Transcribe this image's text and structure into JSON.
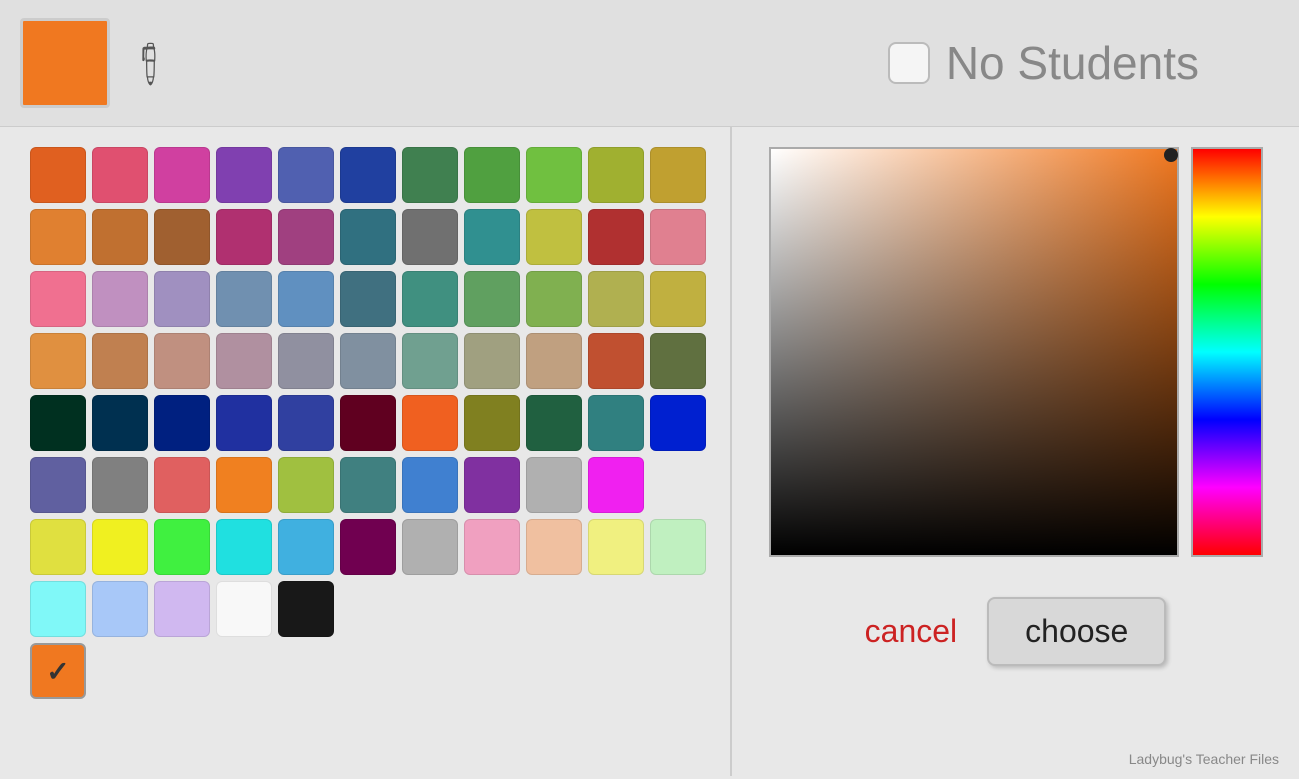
{
  "header": {
    "selected_color": "#f07820",
    "no_students_label": "No Students"
  },
  "palette": {
    "colors": [
      "#e06020",
      "#e05070",
      "#d040a0",
      "#8040b0",
      "#5060b0",
      "#2040a0",
      "#408050",
      "#50a040",
      "#70c040",
      "#a0b030",
      "#c0a030",
      "#e08030",
      "#c07030",
      "#a06030",
      "#b03070",
      "#a04080",
      "#307080",
      "#707070",
      "#309090",
      "#c0c040",
      "#b03030",
      "#e08090",
      "#f07090",
      "#c090c0",
      "#a090c0",
      "#7090b0",
      "#6090c0",
      "#407080",
      "#409080",
      "#60a060",
      "#80b050",
      "#b0b050",
      "#c0b040",
      "#e09040",
      "#c08050",
      "#c09080",
      "#b090a0",
      "#9090a0",
      "#8090a0",
      "#70a090",
      "#a0a080",
      "#c0a080",
      "#c05030",
      "#607040",
      "#003020",
      "#003050",
      "#002080",
      "#2030a0",
      "#3040a0",
      "#600020",
      "#f06020",
      "#808020",
      "#206040",
      "#308080",
      "#0020d0",
      "#6060a0",
      "#808080",
      "#e06060",
      "#f08020",
      "#a0c040",
      "#408080",
      "#4080d0",
      "#8030a0",
      "#b0b0b0",
      "#f020f0",
      "#e0e040",
      "#f0f020",
      "#40f040",
      "#20e0e0",
      "#40b0e0",
      "#700050",
      "#b0b0b0",
      "#f0a0c0",
      "#f0c0a0",
      "#f0f080",
      "#c0f0c0",
      "#80f0f0",
      "#a0c0f0",
      "#d0b0f0",
      "#f8f8f8",
      "#101010"
    ]
  },
  "buttons": {
    "cancel_label": "cancel",
    "choose_label": "choose"
  },
  "footer": {
    "credit": "Ladybug's Teacher Files"
  }
}
